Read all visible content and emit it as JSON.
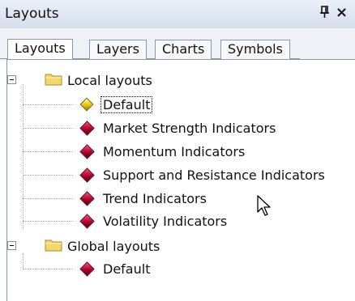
{
  "panel": {
    "title": "Layouts",
    "pin_glyph": "ᵠ",
    "close_glyph": "×"
  },
  "tabs": [
    {
      "label": "Layouts",
      "active": true
    },
    {
      "label": "Layers",
      "active": false
    },
    {
      "label": "Charts",
      "active": false
    },
    {
      "label": "Symbols",
      "active": false
    }
  ],
  "tree": {
    "groups": [
      {
        "label": "Local layouts",
        "expanded": true,
        "items": [
          {
            "label": "Default",
            "icon": "yellow-diamond-icon",
            "selected": true
          },
          {
            "label": "Market Strength Indicators",
            "icon": "red-diamond-icon"
          },
          {
            "label": "Momentum Indicators",
            "icon": "red-diamond-icon"
          },
          {
            "label": "Support and Resistance Indicators",
            "icon": "red-diamond-icon"
          },
          {
            "label": "Trend Indicators",
            "icon": "red-diamond-icon"
          },
          {
            "label": "Volatility Indicators",
            "icon": "red-diamond-icon"
          }
        ]
      },
      {
        "label": "Global layouts",
        "expanded": true,
        "items": [
          {
            "label": "Default",
            "icon": "red-diamond-icon"
          }
        ]
      }
    ]
  },
  "colors": {
    "titlebar": "#d5deeb",
    "border": "#8c97a8",
    "folder": "#f3d76a"
  }
}
